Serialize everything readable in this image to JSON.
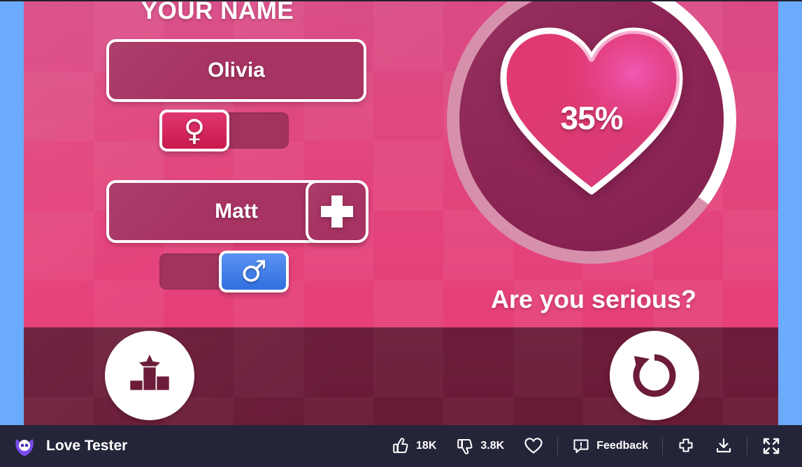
{
  "game": {
    "title_header": "YOUR NAME",
    "person_one": {
      "name": "Olivia",
      "gender": "female",
      "gender_icon": "female-symbol",
      "selected_side": "left"
    },
    "person_two": {
      "name": "Matt",
      "gender": "male",
      "gender_icon": "male-symbol",
      "selected_side": "right"
    },
    "add_button_icon": "plus-icon",
    "result": {
      "percent_label": "35%",
      "percent_value": 35,
      "verdict": "Are you serious?"
    },
    "actions": {
      "leaderboard_icon": "leaderboard-icon",
      "replay_icon": "replay-icon"
    },
    "colors": {
      "stage_pink": "#e1467e",
      "stage_dark": "#6c1c3a",
      "field_fill": "#a63362",
      "female_selected": "#d32a5e",
      "male_selected": "#4080ee",
      "ring_filled": "#ffffff",
      "ring_empty": "#d790ab",
      "heart_fill": "#e03a70",
      "side_bars": "#6aabfb"
    }
  },
  "footer": {
    "game_name": "Love Tester",
    "logo_icon": "poki-owl-logo",
    "likes": {
      "icon": "thumbs-up-icon",
      "count": "18K"
    },
    "dislikes": {
      "icon": "thumbs-down-icon",
      "count": "3.8K"
    },
    "favorite": {
      "icon": "heart-outline-icon"
    },
    "feedback": {
      "icon": "feedback-icon",
      "label": "Feedback"
    },
    "gamepad": {
      "icon": "gamepad-icon"
    },
    "download": {
      "icon": "download-icon"
    },
    "fullscreen": {
      "icon": "fullscreen-icon"
    }
  }
}
